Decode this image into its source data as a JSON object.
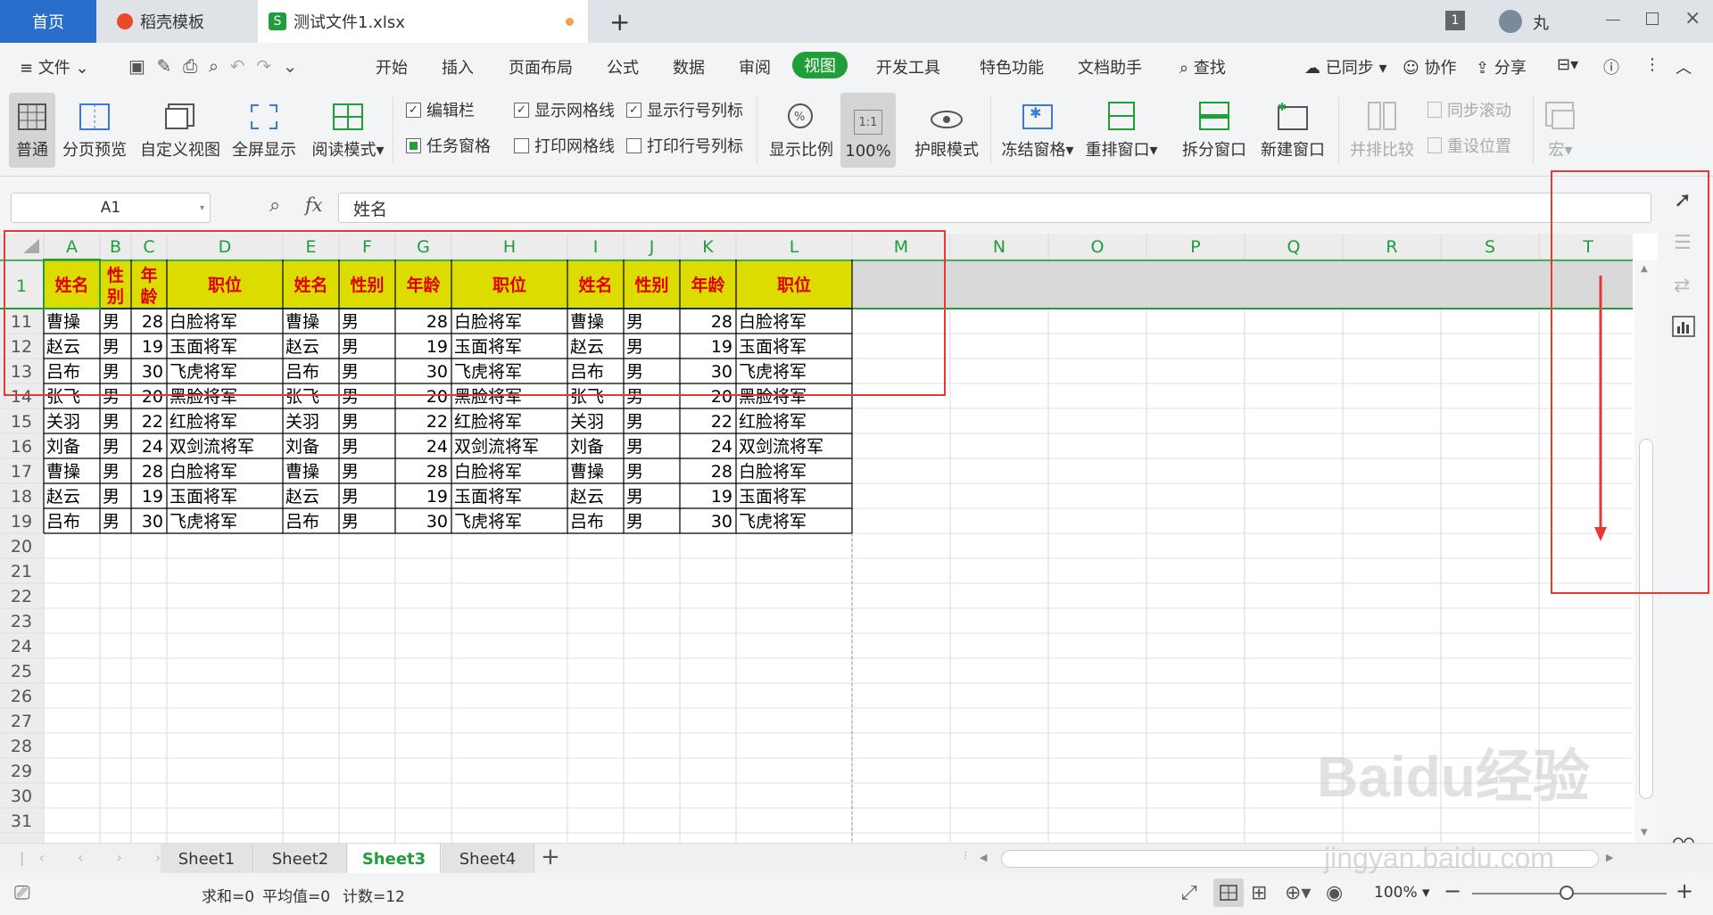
{
  "tabs": {
    "home": "首页",
    "template": "稻壳模板",
    "file": "测试文件1.xlsx",
    "window_count": "1",
    "user": "丸"
  },
  "menu": {
    "file": "文件",
    "items": [
      "开始",
      "插入",
      "页面布局",
      "公式",
      "数据",
      "审阅",
      "视图",
      "开发工具",
      "特色功能",
      "文档助手"
    ],
    "active": "视图",
    "search": "查找",
    "sync": "已同步",
    "collab": "协作",
    "share": "分享"
  },
  "ribbon": {
    "normal": "普通",
    "page_break": "分页预览",
    "custom_view": "自定义视图",
    "fullscreen": "全屏显示",
    "reading": "阅读模式",
    "edit_bar": "编辑栏",
    "task_pane": "任务窗格",
    "show_grid": "显示网格线",
    "print_grid": "打印网格线",
    "show_rowcol": "显示行号列标",
    "print_rowcol": "打印行号列标",
    "zoom": "显示比例",
    "zoom100": "100%",
    "zoom100_icon": "1:1",
    "eye": "护眼模式",
    "freeze": "冻结窗格",
    "rearrange": "重排窗口",
    "split": "拆分窗口",
    "new_window": "新建窗口",
    "side_by_side": "并排比较",
    "sync_scroll": "同步滚动",
    "reset_pos": "重设位置",
    "macro": "宏"
  },
  "formula_bar": {
    "cell_ref": "A1",
    "fx": "fx",
    "value": "姓名"
  },
  "columns": [
    "A",
    "B",
    "C",
    "D",
    "E",
    "F",
    "G",
    "H",
    "I",
    "J",
    "K",
    "L",
    "M",
    "N",
    "O",
    "P",
    "Q",
    "R",
    "S",
    "T"
  ],
  "header_row": {
    "num": "1",
    "cells": [
      "姓名",
      "性别",
      "年龄",
      "职位",
      "姓名",
      "性别",
      "年龄",
      "职位",
      "姓名",
      "性别",
      "年龄",
      "职位"
    ]
  },
  "rows": [
    {
      "num": "11",
      "cells": [
        "曹操",
        "男",
        "28",
        "白脸将军",
        "曹操",
        "男",
        "28",
        "白脸将军",
        "曹操",
        "男",
        "28",
        "白脸将军"
      ]
    },
    {
      "num": "12",
      "cells": [
        "赵云",
        "男",
        "19",
        "玉面将军",
        "赵云",
        "男",
        "19",
        "玉面将军",
        "赵云",
        "男",
        "19",
        "玉面将军"
      ]
    },
    {
      "num": "13",
      "cells": [
        "吕布",
        "男",
        "30",
        "飞虎将军",
        "吕布",
        "男",
        "30",
        "飞虎将军",
        "吕布",
        "男",
        "30",
        "飞虎将军"
      ]
    },
    {
      "num": "14",
      "cells": [
        "张飞",
        "男",
        "20",
        "黑脸将军",
        "张飞",
        "男",
        "20",
        "黑脸将军",
        "张飞",
        "男",
        "20",
        "黑脸将军"
      ]
    },
    {
      "num": "15",
      "cells": [
        "关羽",
        "男",
        "22",
        "红脸将军",
        "关羽",
        "男",
        "22",
        "红脸将军",
        "关羽",
        "男",
        "22",
        "红脸将军"
      ]
    },
    {
      "num": "16",
      "cells": [
        "刘备",
        "男",
        "24",
        "双剑流将军",
        "刘备",
        "男",
        "24",
        "双剑流将军",
        "刘备",
        "男",
        "24",
        "双剑流将军"
      ]
    },
    {
      "num": "17",
      "cells": [
        "曹操",
        "男",
        "28",
        "白脸将军",
        "曹操",
        "男",
        "28",
        "白脸将军",
        "曹操",
        "男",
        "28",
        "白脸将军"
      ]
    },
    {
      "num": "18",
      "cells": [
        "赵云",
        "男",
        "19",
        "玉面将军",
        "赵云",
        "男",
        "19",
        "玉面将军",
        "赵云",
        "男",
        "19",
        "玉面将军"
      ]
    },
    {
      "num": "19",
      "cells": [
        "吕布",
        "男",
        "30",
        "飞虎将军",
        "吕布",
        "男",
        "30",
        "飞虎将军",
        "吕布",
        "男",
        "30",
        "飞虎将军"
      ]
    }
  ],
  "empty_rows": [
    "20",
    "21",
    "22",
    "23",
    "24",
    "25",
    "26",
    "27",
    "28",
    "29",
    "30",
    "31"
  ],
  "sheets": [
    "Sheet1",
    "Sheet2",
    "Sheet3",
    "Sheet4"
  ],
  "active_sheet": "Sheet3",
  "status": {
    "sum": "求和=0",
    "avg": "平均值=0",
    "count": "计数=12",
    "zoom": "100%"
  },
  "colors": {
    "accent": "#2a6ecb",
    "active_green": "#1f9e3a",
    "header_fill": "#dcdc00",
    "header_text": "#e00000",
    "annotation": "#e53935"
  },
  "watermark": {
    "brand": "Baidu经验",
    "url": "jingyan.baidu.com"
  }
}
